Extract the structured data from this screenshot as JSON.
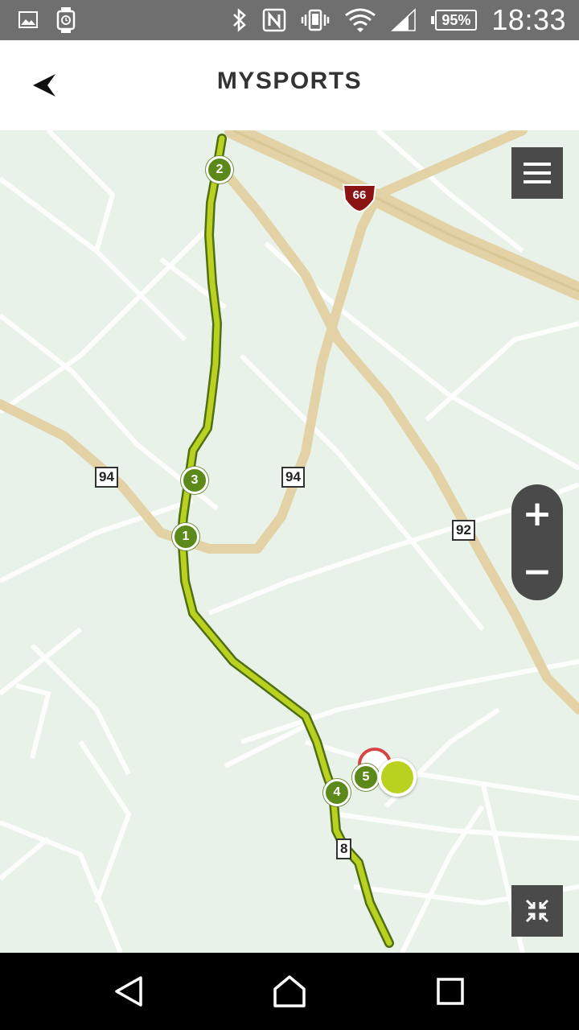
{
  "status_bar": {
    "battery_percent": "95%",
    "battery_level": 0.95,
    "time": "18:33",
    "icons": [
      "gallery-icon",
      "watch-icon",
      "bluetooth-icon",
      "nfc-icon",
      "vibrate-icon",
      "wifi-icon",
      "signal-icon",
      "battery-icon"
    ]
  },
  "app_bar": {
    "title": "MYSPORTS",
    "back_icon": "back-arrow-icon"
  },
  "map": {
    "route_color": "#b9d21f",
    "road_labels": {
      "hwy66": "66",
      "rt94_left": "94",
      "rt94_right": "94",
      "rt92": "92",
      "rt_bottom": "8"
    },
    "lap_markers": [
      "1",
      "2",
      "3",
      "4",
      "5"
    ],
    "controls": {
      "menu_icon": "hamburger-menu-icon",
      "zoom_in": "+",
      "zoom_out": "−",
      "collapse_icon": "collapse-icon"
    }
  },
  "nav_bar": {
    "back": "nav-back-icon",
    "home": "nav-home-icon",
    "recents": "nav-recents-icon"
  }
}
